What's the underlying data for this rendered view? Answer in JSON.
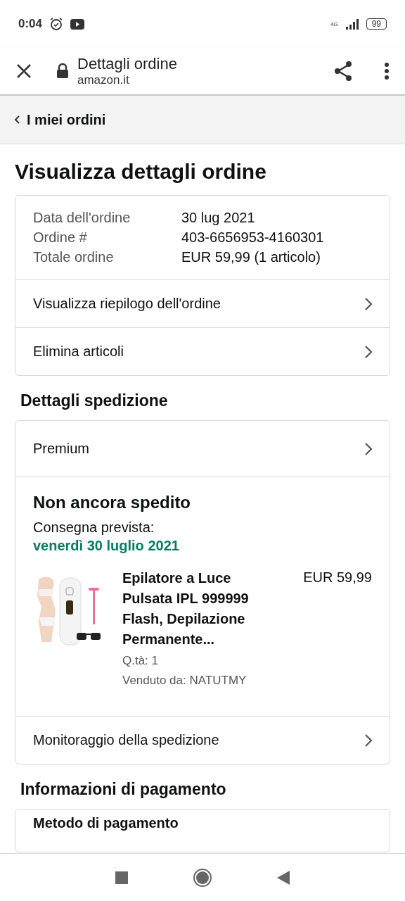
{
  "status_bar": {
    "time": "0:04",
    "network": "4G",
    "battery": "99"
  },
  "toolbar": {
    "title": "Dettagli ordine",
    "url": "amazon.it"
  },
  "breadcrumb": "I miei ordini",
  "page_title": "Visualizza dettagli ordine",
  "order_card": {
    "info": [
      {
        "label": "Data dell'ordine",
        "value": "30 lug 2021"
      },
      {
        "label": "Ordine #",
        "value": "403-6656953-4160301"
      },
      {
        "label": "Totale ordine",
        "value": "EUR 59,99 (1 articolo)"
      }
    ],
    "links": [
      "Visualizza riepilogo dell'ordine",
      "Elimina articoli"
    ]
  },
  "shipping": {
    "heading": "Dettagli spedizione",
    "method": "Premium",
    "status": "Non ancora spedito",
    "delivery_label": "Consegna prevista:",
    "delivery_date": "venerdì 30 luglio 2021",
    "item": {
      "title": "Epilatore a Luce Pulsata IPL 999999 Flash, Depilazione Permanente...",
      "price": "EUR 59,99",
      "quantity": "Q.tà: 1",
      "seller": "Venduto da: NATUTMY"
    },
    "tracking": "Monitoraggio della spedizione"
  },
  "payment": {
    "heading": "Informazioni di pagamento",
    "first_row": "Metodo di pagamento"
  }
}
